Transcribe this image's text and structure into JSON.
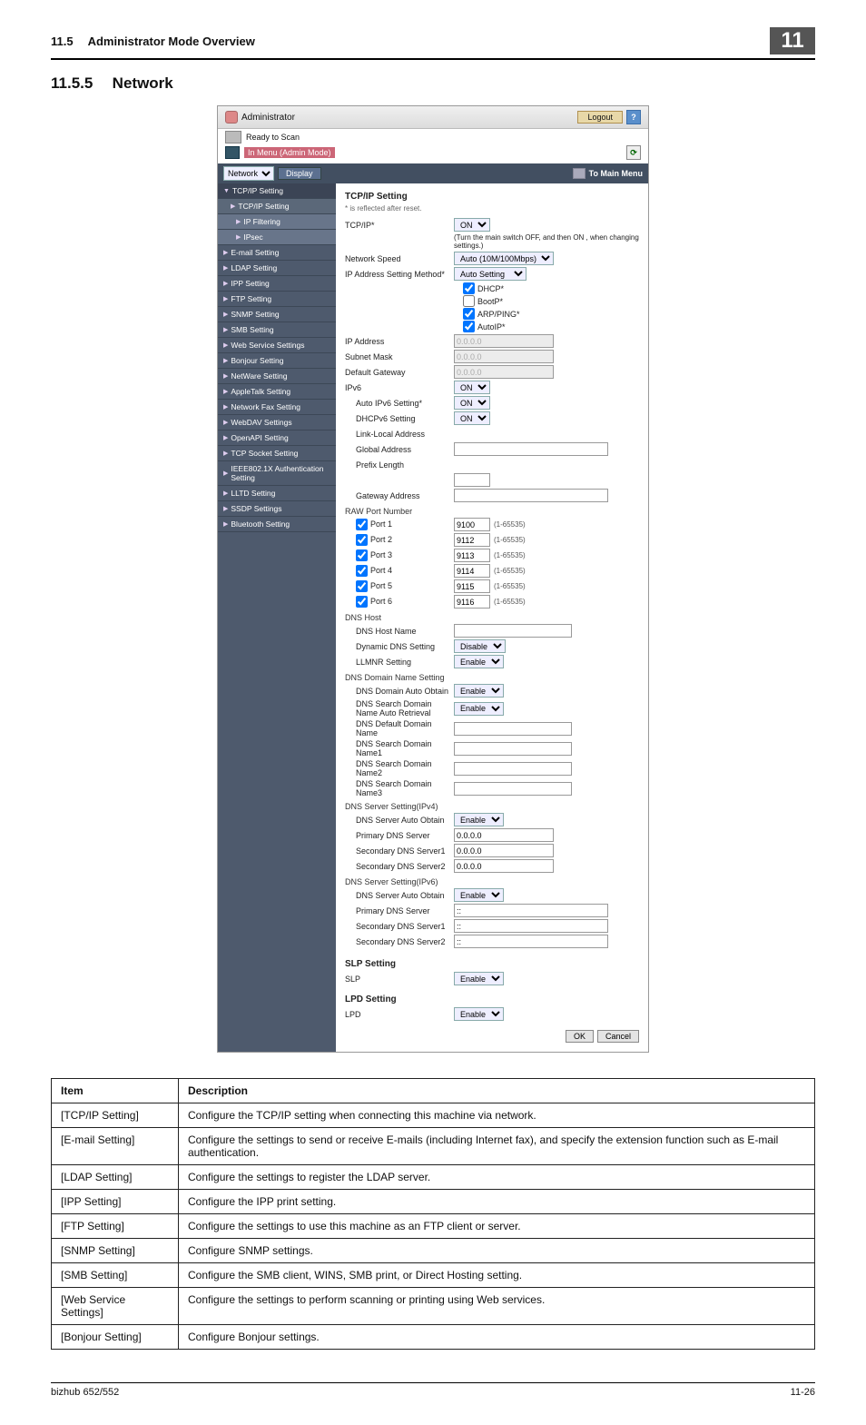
{
  "top": {
    "section": "11.5",
    "title": "Administrator Mode Overview",
    "chapter": "11"
  },
  "heading": {
    "num": "11.5.5",
    "title": "Network"
  },
  "admin": {
    "label": "Administrator",
    "logout": "Logout",
    "help": "?",
    "ready": "Ready to Scan",
    "in_menu": "In Menu (Admin Mode)",
    "reload": "⟳",
    "nav_sel": "Network",
    "display": "Display",
    "to_main": "To Main Menu"
  },
  "sidebar": [
    {
      "label": "TCP/IP Setting",
      "lvl": 0,
      "active": true,
      "arrow": "▼"
    },
    {
      "label": "TCP/IP Setting",
      "lvl": 1,
      "arrow": "▶"
    },
    {
      "label": "IP Filtering",
      "lvl": 2,
      "arrow": "▶"
    },
    {
      "label": "IPsec",
      "lvl": 2,
      "arrow": "▶"
    },
    {
      "label": "E-mail Setting",
      "lvl": 0,
      "arrow": "▶"
    },
    {
      "label": "LDAP Setting",
      "lvl": 0,
      "arrow": "▶"
    },
    {
      "label": "IPP Setting",
      "lvl": 0,
      "arrow": "▶"
    },
    {
      "label": "FTP Setting",
      "lvl": 0,
      "arrow": "▶"
    },
    {
      "label": "SNMP Setting",
      "lvl": 0,
      "arrow": "▶"
    },
    {
      "label": "SMB Setting",
      "lvl": 0,
      "arrow": "▶"
    },
    {
      "label": "Web Service Settings",
      "lvl": 0,
      "arrow": "▶"
    },
    {
      "label": "Bonjour Setting",
      "lvl": 0,
      "arrow": "▶"
    },
    {
      "label": "NetWare Setting",
      "lvl": 0,
      "arrow": "▶"
    },
    {
      "label": "AppleTalk Setting",
      "lvl": 0,
      "arrow": "▶"
    },
    {
      "label": "Network Fax Setting",
      "lvl": 0,
      "arrow": "▶"
    },
    {
      "label": "WebDAV Settings",
      "lvl": 0,
      "arrow": "▶"
    },
    {
      "label": "OpenAPI Setting",
      "lvl": 0,
      "arrow": "▶"
    },
    {
      "label": "TCP Socket Setting",
      "lvl": 0,
      "arrow": "▶"
    },
    {
      "label": "IEEE802.1X Authentication Setting",
      "lvl": 0,
      "arrow": "▶"
    },
    {
      "label": "LLTD Setting",
      "lvl": 0,
      "arrow": "▶"
    },
    {
      "label": "SSDP Settings",
      "lvl": 0,
      "arrow": "▶"
    },
    {
      "label": "Bluetooth Setting",
      "lvl": 0,
      "arrow": "▶"
    }
  ],
  "panel": {
    "title": "TCP/IP Setting",
    "note": "* is reflected after reset.",
    "tcpip_lbl": "TCP/IP*",
    "tcpip_val": "ON",
    "tcpip_hint": "(Turn the main switch OFF, and then ON , when changing settings.)",
    "netspeed_lbl": "Network Speed",
    "netspeed_val": "Auto (10M/100Mbps)",
    "ipmethod_lbl": "IP Address Setting Method*",
    "ipmethod_val": "Auto Setting",
    "dhcp": "DHCP*",
    "bootp": "BootP*",
    "arpping": "ARP/PING*",
    "autoip": "AutoIP*",
    "ipaddr_lbl": "IP Address",
    "ipaddr_val": "0.0.0.0",
    "subnet_lbl": "Subnet Mask",
    "subnet_val": "0.0.0.0",
    "gateway_lbl": "Default Gateway",
    "gateway_val": "0.0.0.0",
    "ipv6_lbl": "IPv6",
    "ipv6_val": "ON",
    "autoipv6_lbl": "Auto IPv6 Setting*",
    "autoipv6_val": "ON",
    "dhcpv6_lbl": "DHCPv6 Setting",
    "dhcpv6_val": "ON",
    "linklocal_lbl": "Link-Local Address",
    "globaladdr_lbl": "Global Address",
    "prefixlen_lbl": "Prefix Length",
    "gatewayaddr_lbl": "Gateway Address",
    "rawport_lbl": "RAW Port Number",
    "ports": [
      {
        "lbl": "Port 1",
        "val": "9100",
        "range": "(1-65535)"
      },
      {
        "lbl": "Port 2",
        "val": "9112",
        "range": "(1-65535)"
      },
      {
        "lbl": "Port 3",
        "val": "9113",
        "range": "(1-65535)"
      },
      {
        "lbl": "Port 4",
        "val": "9114",
        "range": "(1-65535)"
      },
      {
        "lbl": "Port 5",
        "val": "9115",
        "range": "(1-65535)"
      },
      {
        "lbl": "Port 6",
        "val": "9116",
        "range": "(1-65535)"
      }
    ],
    "dnshost_lbl": "DNS Host",
    "dnshostname_lbl": "DNS Host Name",
    "dyndns_lbl": "Dynamic DNS Setting",
    "dyndns_val": "Disable",
    "llmnr_lbl": "LLMNR Setting",
    "llmnr_val": "Enable",
    "dnsdomain_lbl": "DNS Domain Name Setting",
    "dnsdomauto_lbl": "DNS Domain Auto Obtain",
    "dnsdomauto_val": "Enable",
    "dnssearchauto_lbl": "DNS Search Domain Name Auto Retrieval",
    "dnssearchauto_val": "Enable",
    "dnsdefdom_lbl": "DNS Default Domain Name",
    "dnssearch1_lbl": "DNS Search Domain Name1",
    "dnssearch2_lbl": "DNS Search Domain Name2",
    "dnssearch3_lbl": "DNS Search Domain Name3",
    "dnsv4_lbl": "DNS Server Setting(IPv4)",
    "dnsv4auto_lbl": "DNS Server Auto Obtain",
    "dnsv4auto_val": "Enable",
    "primdns_lbl": "Primary DNS Server",
    "primdns_val": "0.0.0.0",
    "secdns1_lbl": "Secondary DNS Server1",
    "secdns1_val": "0.0.0.0",
    "secdns2_lbl": "Secondary DNS Server2",
    "secdns2_val": "0.0.0.0",
    "dnsv6_lbl": "DNS Server Setting(IPv6)",
    "dnsv6auto_lbl": "DNS Server Auto Obtain",
    "dnsv6auto_val": "Enable",
    "primdns6_lbl": "Primary DNS Server",
    "primdns6_val": "::",
    "secdns61_lbl": "Secondary DNS Server1",
    "secdns61_val": "::",
    "secdns62_lbl": "Secondary DNS Server2",
    "secdns62_val": "::",
    "slp_title": "SLP Setting",
    "slp_lbl": "SLP",
    "slp_val": "Enable",
    "lpd_title": "LPD Setting",
    "lpd_lbl": "LPD",
    "lpd_val": "Enable",
    "ok": "OK",
    "cancel": "Cancel"
  },
  "table": {
    "h1": "Item",
    "h2": "Description",
    "rows": [
      {
        "item": "[TCP/IP Setting]",
        "desc": "Configure the TCP/IP setting when connecting this machine via network."
      },
      {
        "item": "[E-mail Setting]",
        "desc": "Configure the settings to send or receive E-mails (including Internet fax), and specify the extension function such as E-mail authentication."
      },
      {
        "item": "[LDAP Setting]",
        "desc": "Configure the settings to register the LDAP server."
      },
      {
        "item": "[IPP Setting]",
        "desc": "Configure the IPP print setting."
      },
      {
        "item": "[FTP Setting]",
        "desc": "Configure the settings to use this machine as an FTP client or server."
      },
      {
        "item": "[SNMP Setting]",
        "desc": "Configure SNMP settings."
      },
      {
        "item": "[SMB Setting]",
        "desc": "Configure the SMB client, WINS, SMB print, or Direct Hosting setting."
      },
      {
        "item": "[Web Service Settings]",
        "desc": "Configure the settings to perform scanning or printing using Web services."
      },
      {
        "item": "[Bonjour Setting]",
        "desc": "Configure Bonjour settings."
      }
    ]
  },
  "footer": {
    "left": "bizhub 652/552",
    "right": "11-26"
  }
}
